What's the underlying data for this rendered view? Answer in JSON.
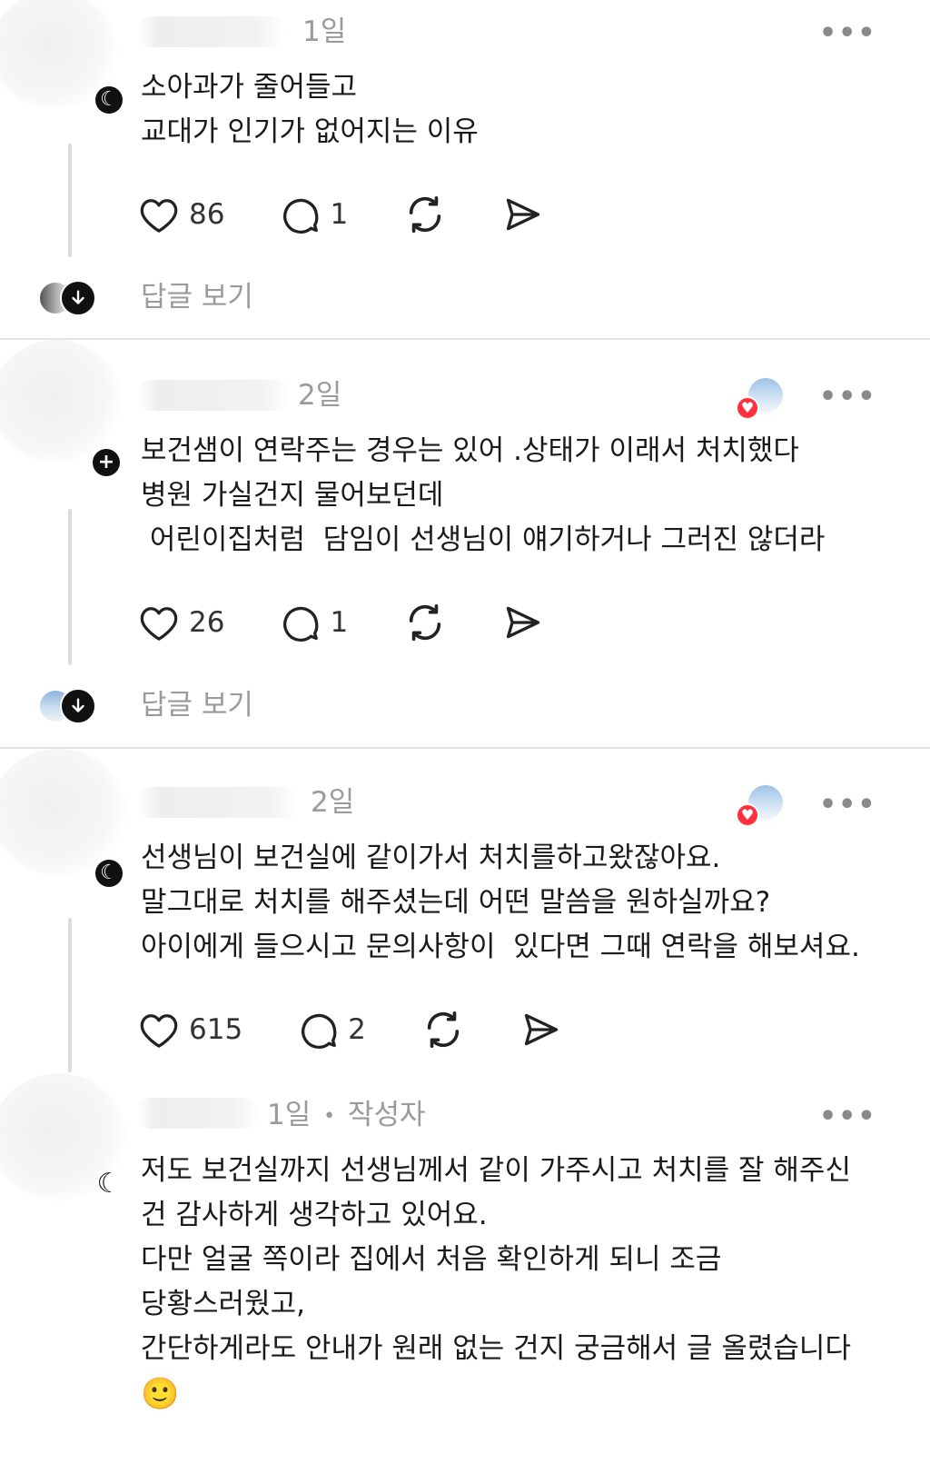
{
  "posts": [
    {
      "time": "1일",
      "lines": [
        "소아과가 줄어들고",
        "교대가 인기가 없어지는 이유"
      ],
      "likes": "86",
      "comments": "1",
      "view_replies": "답글 보기",
      "has_liker": false
    },
    {
      "time": "2일",
      "lines": [
        "보건샘이 연락주는 경우는 있어 .상태가 이래서 처치했다",
        "병원 가실건지 물어보던데",
        " 어린이집처럼  담임이 선생님이 얘기하거나 그러진 않더라"
      ],
      "likes": "26",
      "comments": "1",
      "view_replies": "답글 보기",
      "has_liker": true
    },
    {
      "time": "2일",
      "lines": [
        "선생님이 보건실에 같이가서 처치를하고왔잖아요.",
        "말그대로 처치를 해주셨는데 어떤 말씀을 원하실까요?",
        "아이에게 들으시고 문의사항이  있다면 그때 연락을 해보셔요."
      ],
      "likes": "615",
      "comments": "2",
      "has_liker": true
    },
    {
      "time": "1일",
      "author_tag": "작성자",
      "separator": "•",
      "lines": [
        "저도 보건실까지 선생님께서 같이 가주시고 처치를 잘 해주신",
        "건 감사하게 생각하고 있어요.",
        "다만 얼굴 쪽이라 집에서 처음 확인하게 되니 조금",
        "당황스러웠고,",
        "간단하게라도 안내가 원래 없는 건지 궁금해서 글 올렸습니다"
      ],
      "emoji": "🙂"
    }
  ],
  "more_label": "•••",
  "colors": {
    "like_red": "#ff3040",
    "muted": "#9a9a9a",
    "divider": "#e3e3e3"
  },
  "icons": [
    "heart-icon",
    "comment-icon",
    "repost-icon",
    "share-icon",
    "more-icon",
    "arrow-down-icon",
    "moon-badge-icon",
    "plus-badge-icon"
  ]
}
